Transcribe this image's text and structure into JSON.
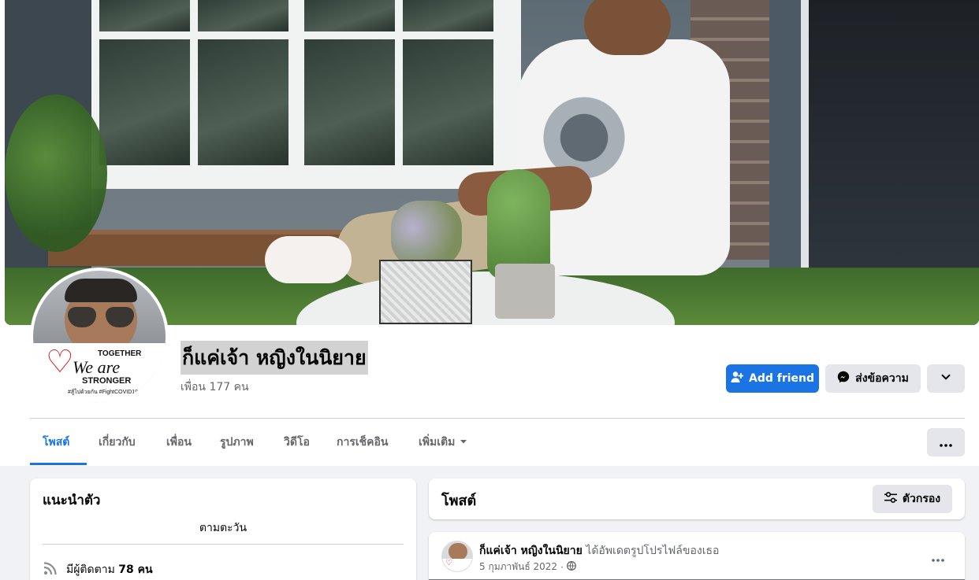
{
  "profile": {
    "name": "ก็แค่เจ้า หญิงในนิยาย",
    "friends_count": "เพื่อน 177 คน"
  },
  "avatar_badge": {
    "line1": "TOGETHER",
    "line2": "We are",
    "line3": "STRONGER",
    "line4": "#สู้ไปด้วยกัน #FightCOVID19"
  },
  "actions": {
    "add_friend": "Add friend",
    "message": "ส่งข้อความ"
  },
  "tabs": [
    {
      "label": "โพสต์",
      "active": true
    },
    {
      "label": "เกี่ยวกับ",
      "active": false
    },
    {
      "label": "เพื่อน",
      "active": false
    },
    {
      "label": "รูปภาพ",
      "active": false
    },
    {
      "label": "วิดีโอ",
      "active": false
    },
    {
      "label": "การเช็คอิน",
      "active": false
    },
    {
      "label": "เพิ่มเติม",
      "active": false
    }
  ],
  "intro": {
    "title": "แนะนำตัว",
    "bio": "ตามตะวัน",
    "followers_prefix": "มีผู้ติดตาม ",
    "followers_count": "78 คน"
  },
  "posts": {
    "title": "โพสต์",
    "filter_label": "ตัวกรอง"
  },
  "post": {
    "author": "ก็แค่เจ้า หญิงในนิยาย",
    "action": "ได้อัพเดตรูปโปรไฟล์ของเธอ",
    "date": "5 กุมภาพันธ์ 2022",
    "separator": "·"
  },
  "colors": {
    "accent": "#1b74e4",
    "page_bg": "#f0f2f5",
    "button_gray": "#e4e6eb",
    "secondary_text": "#65676b"
  },
  "icons": {
    "add_friend": "person-plus-icon",
    "message": "messenger-icon",
    "dropdown": "chevron-down-icon",
    "more": "ellipsis-icon",
    "filter": "sliders-icon",
    "followers": "rss-icon",
    "privacy": "globe-icon",
    "tab_dropdown": "caret-down-icon"
  }
}
